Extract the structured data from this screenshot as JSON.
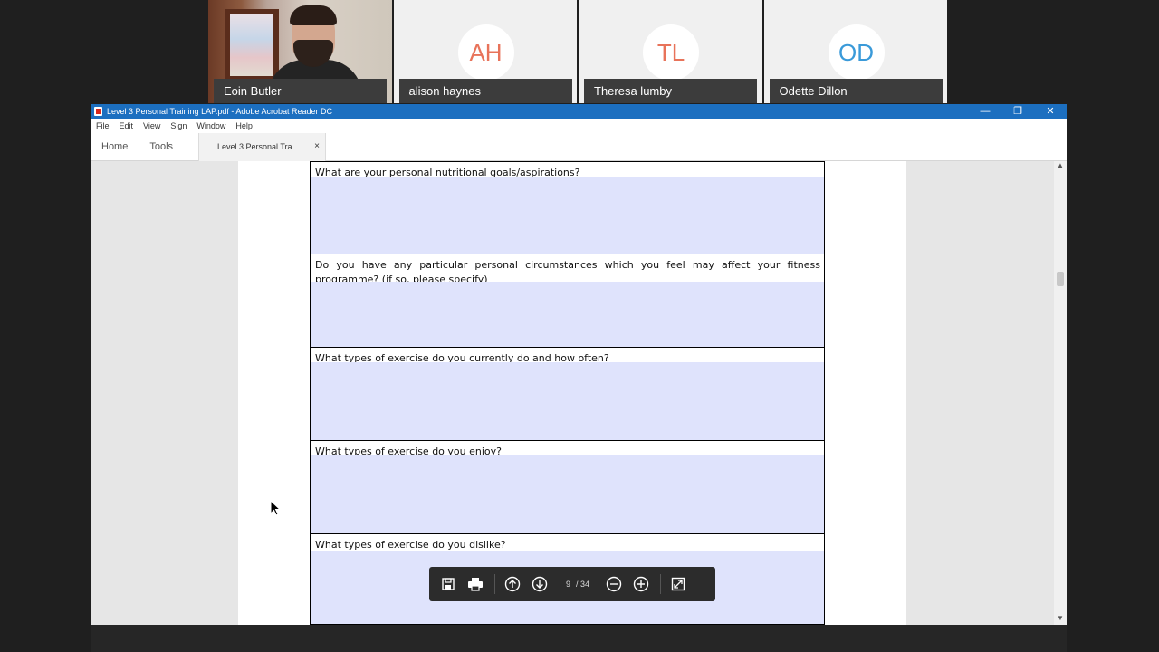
{
  "participants": [
    {
      "name": "Eoin Butler",
      "initials": "",
      "color": ""
    },
    {
      "name": "alison haynes",
      "initials": "AH",
      "color": "#e8735a"
    },
    {
      "name": "Theresa lumby",
      "initials": "TL",
      "color": "#e8735a"
    },
    {
      "name": "Odette Dillon",
      "initials": "OD",
      "color": "#3a9ad9"
    }
  ],
  "window": {
    "title": "Level 3 Personal Training LAP.pdf - Adobe Acrobat Reader DC",
    "controls": {
      "minimize": "—",
      "restore": "❐",
      "close": "✕"
    }
  },
  "menu": [
    "File",
    "Edit",
    "View",
    "Sign",
    "Window",
    "Help"
  ],
  "nav": {
    "home": "Home",
    "tools": "Tools"
  },
  "doc_tab": {
    "label": "Level 3 Personal Tra...",
    "close": "×"
  },
  "form": [
    {
      "question": "What are your personal nutritional goals/aspirations?"
    },
    {
      "question": "Do you have any particular personal circumstances which you feel may affect your fitness programme? (if so, please specify)"
    },
    {
      "question": "What types of exercise do you currently do and how often?"
    },
    {
      "question": "What types of exercise do you enjoy?"
    },
    {
      "question": "What types of exercise do you dislike?"
    }
  ],
  "toolbar": {
    "current_page": "9",
    "total_pages": "/ 34",
    "icons": [
      "save-icon",
      "print-icon",
      "page-up-icon",
      "page-down-icon",
      "zoom-out-icon",
      "zoom-in-icon",
      "fit-page-icon"
    ]
  },
  "colors": {
    "titlebar": "#1c6fc0",
    "form_field": "#dfe3fc"
  }
}
